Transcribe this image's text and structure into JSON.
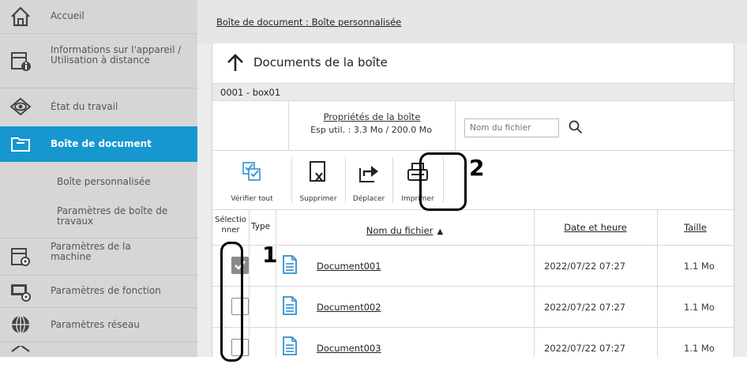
{
  "sidebar": {
    "items": [
      {
        "label": "Accueil",
        "icon": "home-icon"
      },
      {
        "label": "Informations sur l'appareil / Utilisation à distance",
        "icon": "device-info-icon"
      },
      {
        "label": "État du travail",
        "icon": "eye-icon"
      },
      {
        "label": "Boîte de document",
        "icon": "folder-icon",
        "active": true
      },
      {
        "label": "Boîte personnalisée"
      },
      {
        "label": "Paramètres de boîte de travaux"
      },
      {
        "label": "Paramètres de la machine",
        "icon": "machine-settings-icon"
      },
      {
        "label": "Paramètres de fonction",
        "icon": "function-settings-icon"
      },
      {
        "label": "Paramètres réseau",
        "icon": "globe-icon"
      }
    ]
  },
  "breadcrumb": "Boîte de document : Boîte personnalisée",
  "panel": {
    "title": "Documents de la boîte",
    "box_id": "0001 - box01",
    "properties_link": "Propriétés de la boîte",
    "properties_info": "Esp util. : 3.3 Mo / 200.0 Mo",
    "search_placeholder": "Nom du fichier"
  },
  "toolbar": {
    "check_all": "Vérifier tout",
    "delete": "Supprimer",
    "move": "Déplacer",
    "print": "Imprimer"
  },
  "table": {
    "headers": {
      "select": "Sélectionner",
      "type": "Type",
      "name": "Nom du fichier",
      "date": "Date et heure",
      "size": "Taille"
    },
    "rows": [
      {
        "name": "Document001",
        "date": "2022/07/22 07:27",
        "size": "1.1 Mo",
        "checked": true
      },
      {
        "name": "Document002",
        "date": "2022/07/22 07:27",
        "size": "1.1 Mo",
        "checked": false
      },
      {
        "name": "Document003",
        "date": "2022/07/22 07:27",
        "size": "1.1 Mo",
        "checked": false
      }
    ]
  },
  "callouts": {
    "one": "1",
    "two": "2"
  },
  "colors": {
    "accent": "#1797cf",
    "sidebar_bg": "#d6d6d6",
    "doc_icon": "#2f8fd0"
  }
}
